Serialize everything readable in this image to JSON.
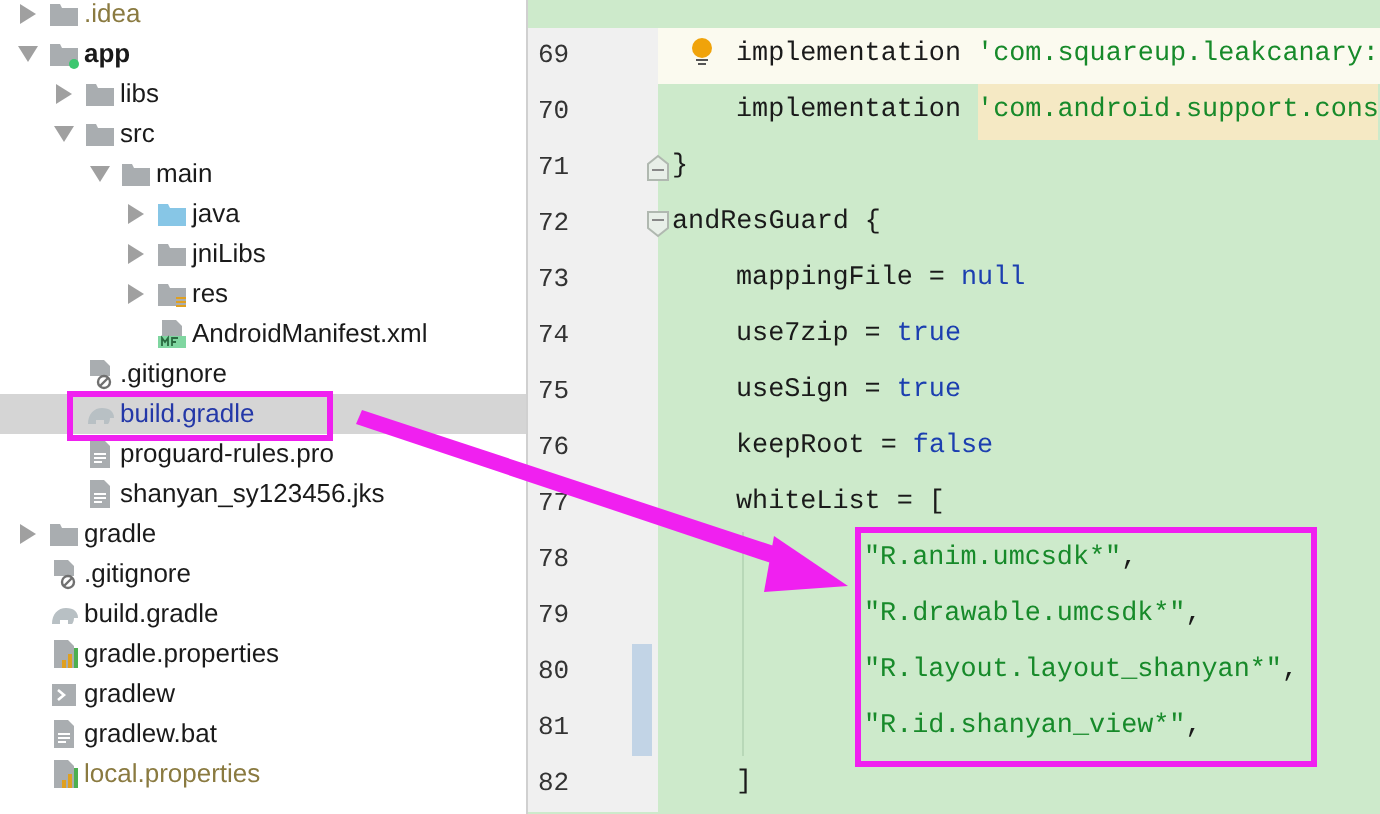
{
  "project_tree": {
    "items": [
      {
        "label": ".idea",
        "kind": "folder",
        "ignored": true,
        "modified": false,
        "expanded": false,
        "selected": false
      },
      {
        "label": "app",
        "kind": "module",
        "ignored": false,
        "modified": false,
        "expanded": true,
        "selected": false,
        "children": [
          {
            "label": "libs",
            "kind": "folder",
            "ignored": false,
            "modified": false,
            "expanded": false,
            "selected": false
          },
          {
            "label": "src",
            "kind": "folder",
            "ignored": false,
            "modified": false,
            "expanded": true,
            "selected": false,
            "children": [
              {
                "label": "main",
                "kind": "folder",
                "ignored": false,
                "modified": false,
                "expanded": true,
                "selected": false,
                "children": [
                  {
                    "label": "java",
                    "kind": "source-folder",
                    "ignored": false,
                    "modified": false,
                    "expanded": false,
                    "selected": false
                  },
                  {
                    "label": "jniLibs",
                    "kind": "folder",
                    "ignored": false,
                    "modified": false,
                    "expanded": false,
                    "selected": false
                  },
                  {
                    "label": "res",
                    "kind": "resource-folder",
                    "ignored": false,
                    "modified": false,
                    "expanded": false,
                    "selected": false
                  },
                  {
                    "label": "AndroidManifest.xml",
                    "kind": "manifest",
                    "ignored": false,
                    "modified": false,
                    "selected": false
                  }
                ]
              }
            ]
          },
          {
            "label": ".gitignore",
            "kind": "ignore-file",
            "ignored": false,
            "modified": false,
            "selected": false
          },
          {
            "label": "build.gradle",
            "kind": "gradle",
            "ignored": false,
            "modified": true,
            "selected": true
          },
          {
            "label": "proguard-rules.pro",
            "kind": "text",
            "ignored": false,
            "modified": false,
            "selected": false
          },
          {
            "label": "shanyan_sy123456.jks",
            "kind": "text",
            "ignored": false,
            "modified": false,
            "selected": false
          }
        ]
      },
      {
        "label": "gradle",
        "kind": "folder",
        "ignored": false,
        "modified": false,
        "expanded": false,
        "selected": false
      },
      {
        "label": ".gitignore",
        "kind": "ignore-file",
        "ignored": false,
        "modified": false,
        "selected": false
      },
      {
        "label": "build.gradle",
        "kind": "gradle",
        "ignored": false,
        "modified": false,
        "selected": false
      },
      {
        "label": "gradle.properties",
        "kind": "properties",
        "ignored": false,
        "modified": false,
        "selected": false
      },
      {
        "label": "gradlew",
        "kind": "script",
        "ignored": false,
        "modified": false,
        "selected": false
      },
      {
        "label": "gradlew.bat",
        "kind": "text",
        "ignored": false,
        "modified": false,
        "selected": false
      },
      {
        "label": "local.properties",
        "kind": "properties",
        "ignored": true,
        "modified": false,
        "selected": false
      }
    ]
  },
  "editor": {
    "lines": [
      {
        "number": "69",
        "kind": "body",
        "current": true,
        "intention": true,
        "tokens": [
          {
            "text": "implementation ",
            "kind": "plain"
          },
          {
            "text": "'com.squareup.leakcanary:",
            "kind": "string"
          }
        ]
      },
      {
        "number": "70",
        "kind": "body",
        "current": false,
        "tokens": [
          {
            "text": "implementation ",
            "kind": "plain"
          },
          {
            "text": "'com.android.support.cons",
            "kind": "string",
            "warning": true
          }
        ]
      },
      {
        "number": "71",
        "kind": "top",
        "current": false,
        "fold_end": true,
        "tokens": [
          {
            "text": "}",
            "kind": "plain"
          }
        ]
      },
      {
        "number": "72",
        "kind": "top",
        "current": false,
        "fold_start": true,
        "tokens": [
          {
            "text": "andResGuard {",
            "kind": "plain"
          }
        ]
      },
      {
        "number": "73",
        "kind": "body",
        "current": false,
        "tokens": [
          {
            "text": "mappingFile = ",
            "kind": "plain"
          },
          {
            "text": "null",
            "kind": "keyword"
          }
        ]
      },
      {
        "number": "74",
        "kind": "body",
        "current": false,
        "tokens": [
          {
            "text": "use7zip = ",
            "kind": "plain"
          },
          {
            "text": "true",
            "kind": "keyword"
          }
        ]
      },
      {
        "number": "75",
        "kind": "body",
        "current": false,
        "tokens": [
          {
            "text": "useSign = ",
            "kind": "plain"
          },
          {
            "text": "true",
            "kind": "keyword"
          }
        ]
      },
      {
        "number": "76",
        "kind": "body",
        "current": false,
        "tokens": [
          {
            "text": "keepRoot = ",
            "kind": "plain"
          },
          {
            "text": "false",
            "kind": "keyword"
          }
        ]
      },
      {
        "number": "77",
        "kind": "body",
        "current": false,
        "tokens": [
          {
            "text": "whiteList = [",
            "kind": "plain"
          }
        ]
      },
      {
        "number": "78",
        "kind": "list-item",
        "current": false,
        "tokens": [
          {
            "text": "\"R.anim.umcsdk*\"",
            "kind": "string"
          },
          {
            "text": ",",
            "kind": "plain"
          }
        ]
      },
      {
        "number": "79",
        "kind": "list-item",
        "current": false,
        "tokens": [
          {
            "text": "\"R.drawable.umcsdk*\"",
            "kind": "string"
          },
          {
            "text": ",",
            "kind": "plain"
          }
        ]
      },
      {
        "number": "80",
        "kind": "list-item",
        "current": false,
        "changed": true,
        "tokens": [
          {
            "text": "\"R.layout.layout_shanyan*\"",
            "kind": "string"
          },
          {
            "text": ",",
            "kind": "plain"
          }
        ]
      },
      {
        "number": "81",
        "kind": "list-item",
        "current": false,
        "changed": true,
        "tokens": [
          {
            "text": "\"R.id.shanyan_view*\"",
            "kind": "string"
          },
          {
            "text": ",",
            "kind": "plain"
          }
        ]
      },
      {
        "number": "82",
        "kind": "body",
        "current": false,
        "tokens": [
          {
            "text": "]",
            "kind": "plain"
          }
        ]
      }
    ]
  }
}
